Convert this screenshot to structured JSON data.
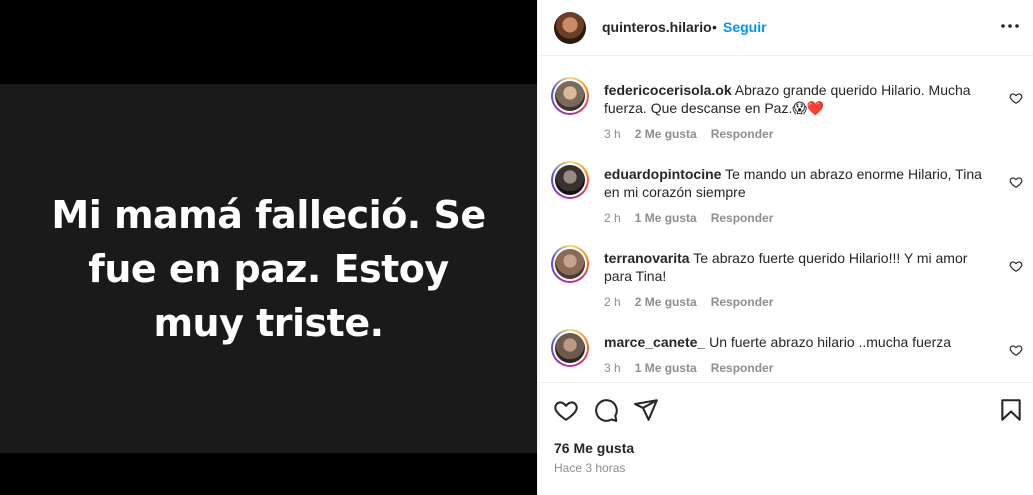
{
  "post": {
    "image_text": "Mi mamá falleció. Se fue en paz. Estoy muy triste."
  },
  "header": {
    "username": "quinteros.hilario",
    "separator": "•",
    "follow_label": "Seguir"
  },
  "comments": [
    {
      "user": "federicocerisola.ok",
      "text": "Abrazo grande querido Hilario. Mucha fuerza. Que descanse en Paz.😱❤️",
      "time": "3 h",
      "likes": "2 Me gusta",
      "reply": "Responder"
    },
    {
      "user": "eduardopintocine",
      "text": "Te mando un abrazo enorme Hilario, Tina en mi corazón siempre",
      "time": "2 h",
      "likes": "1 Me gusta",
      "reply": "Responder"
    },
    {
      "user": "terranovarita",
      "text": "Te abrazo fuerte querido Hilario!!! Y mi amor para Tina!",
      "time": "2 h",
      "likes": "2 Me gusta",
      "reply": "Responder"
    },
    {
      "user": "marce_canete_",
      "text": "Un fuerte abrazo hilario ..mucha fuerza",
      "time": "3 h",
      "likes": "1 Me gusta",
      "reply": "Responder"
    }
  ],
  "footer": {
    "likes": "76 Me gusta",
    "posted": "Hace 3 horas"
  },
  "colors": {
    "follow": "#0095f6",
    "text": "#262626",
    "muted": "#8e8e8e",
    "media_bg": "#1a1a1a"
  }
}
